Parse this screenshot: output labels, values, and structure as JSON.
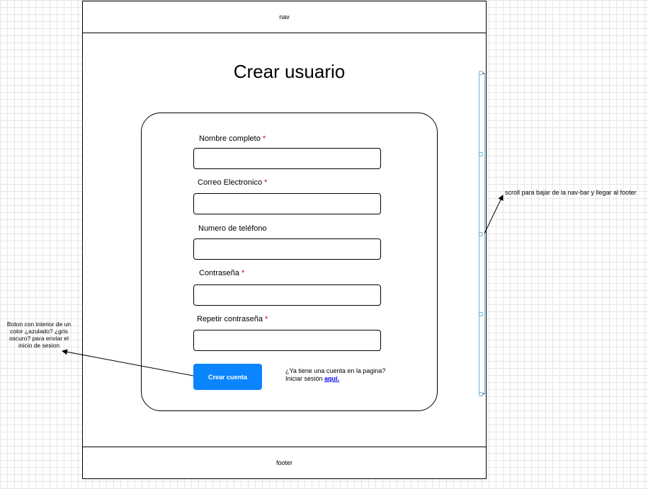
{
  "nav": {
    "label": "nav"
  },
  "footer": {
    "label": "footer"
  },
  "page": {
    "title": "Crear usuario"
  },
  "form": {
    "required_marker": "*",
    "fields": [
      {
        "label": "Nombre completo",
        "required": true
      },
      {
        "label": "Correo Electronico",
        "required": true
      },
      {
        "label": "Numero de teléfono",
        "required": false
      },
      {
        "label": "Contraseña",
        "required": true
      },
      {
        "label": "Repetir contraseña",
        "required": true
      }
    ],
    "submit_label": "Crear cuenta",
    "login_prompt_line1": "¿Ya tiene una cuenta en la pagina?",
    "login_prompt_line2": "Iniciar sesión",
    "login_link": "aquí."
  },
  "annotations": {
    "scroll_note": "scroll para bajar de la nav-bar y llegar al footer",
    "button_note": "Boton con interior de un color ¿azulado? ¿gris oscuro? para enviar el inicio de sesion"
  },
  "colors": {
    "button": "#0a84ff",
    "required": "#cc0000",
    "link": "#0000ee"
  }
}
